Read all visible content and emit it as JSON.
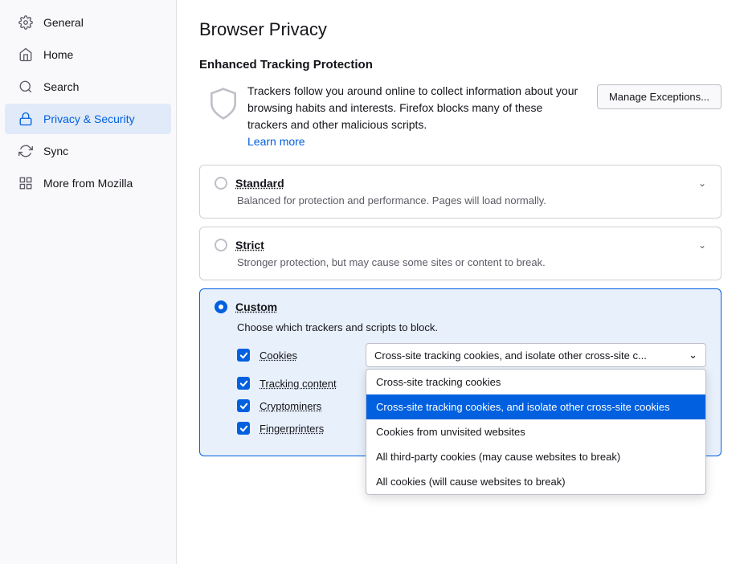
{
  "sidebar": {
    "items": [
      {
        "id": "general",
        "label": "General",
        "icon": "gear"
      },
      {
        "id": "home",
        "label": "Home",
        "icon": "home"
      },
      {
        "id": "search",
        "label": "Search",
        "icon": "search"
      },
      {
        "id": "privacy",
        "label": "Privacy & Security",
        "icon": "lock",
        "active": true
      },
      {
        "id": "sync",
        "label": "Sync",
        "icon": "sync"
      },
      {
        "id": "mozilla",
        "label": "More from Mozilla",
        "icon": "mozilla"
      }
    ]
  },
  "main": {
    "page_title": "Browser Privacy",
    "etp": {
      "section_title": "Enhanced Tracking Protection",
      "description": "Trackers follow you around online to collect information about your browsing habits and interests. Firefox blocks many of these trackers and other malicious scripts.",
      "learn_more": "Learn more",
      "manage_button": "Manage Exceptions..."
    },
    "options": [
      {
        "id": "standard",
        "label": "Standard",
        "desc": "Balanced for protection and performance. Pages will load normally.",
        "checked": false
      },
      {
        "id": "strict",
        "label": "Strict",
        "desc": "Stronger protection, but may cause some sites or content to break.",
        "checked": false
      },
      {
        "id": "custom",
        "label": "Custom",
        "checked": true,
        "custom_desc": "Choose which trackers and scripts to block.",
        "rows": [
          {
            "id": "cookies",
            "label": "Cookies",
            "checked": true,
            "dropdown_value": "Cross-site tracking cookies, and isolate other cross-site c...",
            "dropdown_open": true,
            "dropdown_items": [
              {
                "label": "Cross-site tracking cookies",
                "selected": false
              },
              {
                "label": "Cross-site tracking cookies, and isolate other cross-site cookies",
                "selected": true
              },
              {
                "label": "Cookies from unvisited websites",
                "selected": false
              },
              {
                "label": "All third-party cookies (may cause websites to break)",
                "selected": false
              },
              {
                "label": "All cookies (will cause websites to break)",
                "selected": false
              }
            ]
          },
          {
            "id": "tracking",
            "label": "Tracking content",
            "checked": true
          },
          {
            "id": "crypto",
            "label": "Cryptominers",
            "checked": true
          },
          {
            "id": "fingerprinters",
            "label": "Fingerprinters",
            "checked": true
          }
        ]
      }
    ]
  }
}
